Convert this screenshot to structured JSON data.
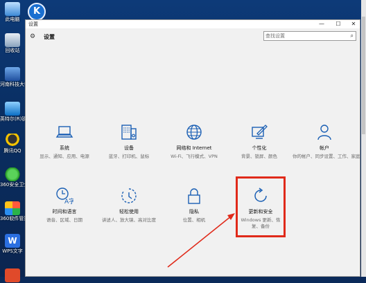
{
  "desktop": {
    "icons": [
      {
        "label": "此电脑"
      },
      {
        "label": "回收站"
      },
      {
        "label": "河南科技大学"
      },
      {
        "label": "英特尔(R)锐炬"
      },
      {
        "label": "腾讯QQ"
      },
      {
        "label": "360安全卫士"
      },
      {
        "label": "360软件管家"
      },
      {
        "label": "WPS文字"
      }
    ],
    "launcher_letter": "K"
  },
  "window": {
    "title": "设置",
    "controls": {
      "minimize": "—",
      "maximize": "☐",
      "close": "✕"
    }
  },
  "header": {
    "title": "设置",
    "search_placeholder": "查找设置"
  },
  "tiles": [
    {
      "name": "系统",
      "desc": "显示、通知、应用、电源",
      "icon": "laptop-icon"
    },
    {
      "name": "设备",
      "desc": "蓝牙、打印机、鼠标",
      "icon": "keyboard-icon"
    },
    {
      "name": "网络和 Internet",
      "desc": "Wi-Fi、飞行模式、VPN",
      "icon": "globe-icon"
    },
    {
      "name": "个性化",
      "desc": "背景、锁屏、颜色",
      "icon": "paint-icon"
    },
    {
      "name": "帐户",
      "desc": "你的帐户、同步设置、工作、家庭",
      "icon": "person-icon"
    },
    {
      "name": "时间和语言",
      "desc": "语音、区域、日期",
      "icon": "clock-language-icon"
    },
    {
      "name": "轻松使用",
      "desc": "讲述人、放大镜、高对比度",
      "icon": "ease-of-access-icon"
    },
    {
      "name": "隐私",
      "desc": "位置、相机",
      "icon": "lock-icon"
    },
    {
      "name": "更新和安全",
      "desc": "Windows 更新、恢复、备份",
      "icon": "refresh-icon"
    }
  ],
  "annotation": {
    "color": "#e02a1a"
  }
}
